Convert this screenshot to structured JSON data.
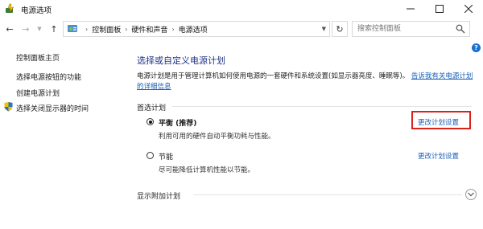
{
  "window": {
    "title": "电源选项",
    "icon": "power-options-icon"
  },
  "nav": {
    "breadcrumbs": [
      "控制面板",
      "硬件和声音",
      "电源选项"
    ],
    "search_placeholder": "搜索控制面板"
  },
  "sidebar": {
    "home": "控制面板主页",
    "items": [
      "选择电源按钮的功能",
      "创建电源计划",
      "选择关闭显示器的时间"
    ]
  },
  "main": {
    "title": "选择或自定义电源计划",
    "description": "电源计划是用于管理计算机如何使用电源的一套硬件和系统设置(如显示器亮度、睡眠等)。",
    "description_link": "告诉我有关电源计划的详细信息",
    "preferred_section": "首选计划",
    "plans": [
      {
        "name": "平衡 (推荐)",
        "desc": "利用可用的硬件自动平衡功耗与性能。",
        "selected": true,
        "change_label": "更改计划设置"
      },
      {
        "name": "节能",
        "desc": "尽可能降低计算机性能以节能。",
        "selected": false,
        "change_label": "更改计划设置"
      }
    ],
    "more_section": "显示附加计划"
  },
  "colors": {
    "title_blue": "#1e3287",
    "link_blue": "#1a5fb4",
    "highlight_red": "#d9241b"
  }
}
